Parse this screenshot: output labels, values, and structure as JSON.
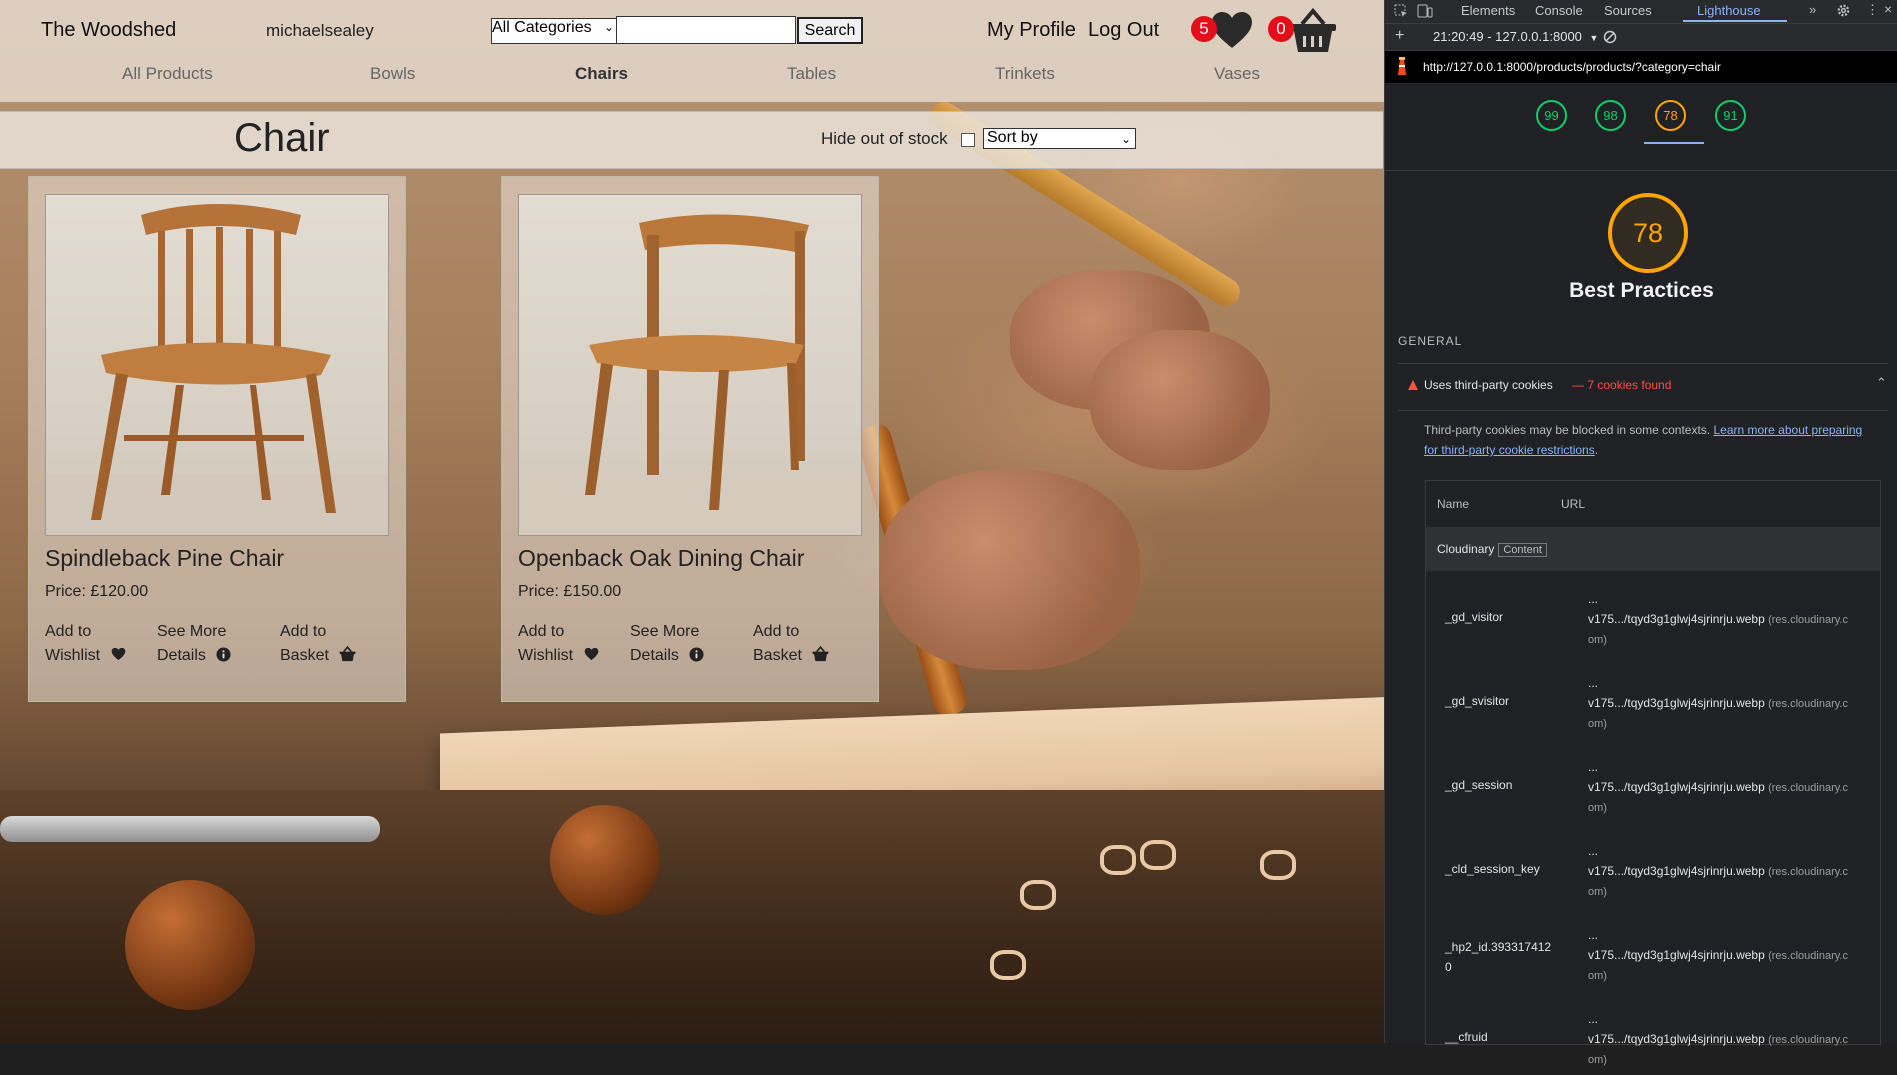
{
  "header": {
    "brand": "The Woodshed",
    "username": "michaelsealey",
    "category_select": "All Categories",
    "search_value": "",
    "search_button": "Search",
    "my_profile": "My Profile",
    "log_out": "Log Out",
    "wishlist_count": "5",
    "basket_count": "0"
  },
  "category_nav": [
    "All Products",
    "Bowls",
    "Chairs",
    "Tables",
    "Trinkets",
    "Vases"
  ],
  "active_category": "Chairs",
  "listing": {
    "title": "Chair",
    "hide_out_of_stock": "Hide out of stock",
    "sort_by": "Sort by"
  },
  "products": [
    {
      "name": "Spindleback Pine Chair",
      "price": "Price: £120.00",
      "wishlist": [
        "Add to",
        "Wishlist"
      ],
      "details": [
        "See More",
        "Details"
      ],
      "basket": [
        "Add to",
        "Basket"
      ]
    },
    {
      "name": "Openback Oak Dining Chair",
      "price": "Price: £150.00",
      "wishlist": [
        "Add to",
        "Wishlist"
      ],
      "details": [
        "See More",
        "Details"
      ],
      "basket": [
        "Add to",
        "Basket"
      ]
    }
  ],
  "devtools": {
    "tabs": [
      "Elements",
      "Console",
      "Sources",
      "Lighthouse"
    ],
    "active_tab": "Lighthouse",
    "report_select": "21:20:49 - 127.0.0.1:8000",
    "url": "http://127.0.0.1:8000/products/products/?category=chair",
    "scores": [
      "99",
      "98",
      "78",
      "91"
    ],
    "main_score": "78",
    "category_title": "Best Practices",
    "section": "GENERAL",
    "audit_title": "Uses third-party cookies",
    "audit_count": "— 7 cookies found",
    "audit_desc_text": "Third-party cookies may be blocked in some contexts. ",
    "audit_link": "Learn more about preparing for third-party cookie restrictions",
    "audit_desc_end": ".",
    "table_headers": [
      "Name",
      "URL"
    ],
    "entity": "Cloudinary",
    "entity_tag": "Content",
    "cookies": [
      {
        "name": "_gd_visitor",
        "ellipsis": "...",
        "url": "v175.../tqyd3g1glwj4sjrinrju.webp",
        "domain1": "(res.cloudinary.c",
        "domain2": "om)"
      },
      {
        "name": "_gd_svisitor",
        "ellipsis": "...",
        "url": "v175.../tqyd3g1glwj4sjrinrju.webp",
        "domain1": "(res.cloudinary.c",
        "domain2": "om)"
      },
      {
        "name": "_gd_session",
        "ellipsis": "...",
        "url": "v175.../tqyd3g1glwj4sjrinrju.webp",
        "domain1": "(res.cloudinary.c",
        "domain2": "om)"
      },
      {
        "name": "_cld_session_key",
        "ellipsis": "...",
        "url": "v175.../tqyd3g1glwj4sjrinrju.webp",
        "domain1": "(res.cloudinary.c",
        "domain2": "om)"
      },
      {
        "name": "_hp2_id.3933174120",
        "ellipsis": "...",
        "url": "v175.../tqyd3g1glwj4sjrinrju.webp",
        "domain1": "(res.cloudinary.c",
        "domain2": "om)"
      },
      {
        "name": "__cfruid",
        "ellipsis": "...",
        "url": "v175.../tqyd3g1glwj4sjrinrju.webp",
        "domain1": "(res.cloudinary.c",
        "domain2": "om)"
      }
    ]
  },
  "colors": {
    "badge": "#e20f1a",
    "score_good": "#0cce6b",
    "score_average": "#ffa400",
    "warning": "#ff4e42",
    "link": "#8ab4f8"
  }
}
